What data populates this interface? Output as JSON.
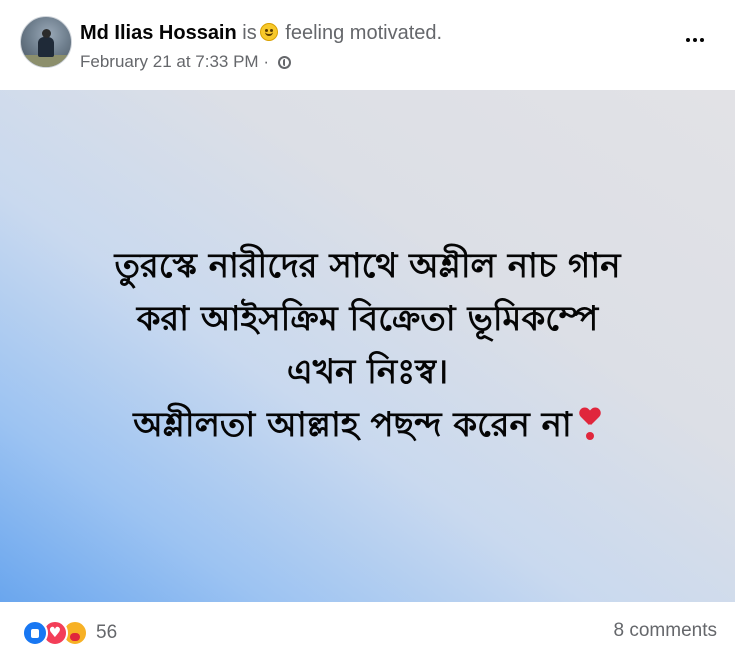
{
  "header": {
    "author_name": "Md Ilias Hossain",
    "is_text": "is",
    "feeling_text": "feeling motivated.",
    "timestamp": "February 21 at 7:33 PM",
    "separator": "·",
    "privacy_icon": "globe-icon",
    "more_icon": "more-options-icon"
  },
  "post": {
    "text_lines": [
      "তুরস্কে নারীদের সাথে অশ্লীল নাচ গান",
      "করা আইসক্রিম বিক্রেতা ভূমিকম্পে",
      "এখন নিঃস্ব।",
      "অশ্লীলতা আল্লাহ পছন্দ করেন না"
    ],
    "trailing_emoji": "heavy-heart-exclamation-icon"
  },
  "footer": {
    "reaction_icons": [
      "like-icon",
      "love-icon",
      "care-icon"
    ],
    "reaction_count": "56",
    "comments_label": "8 comments"
  },
  "colors": {
    "secondary_text": "#65676b",
    "like_blue": "#1877f2",
    "love_red": "#f33e58",
    "care_yellow": "#f7b125",
    "gradient_start": "#6aa6ee",
    "gradient_end": "#e2e2e6"
  }
}
